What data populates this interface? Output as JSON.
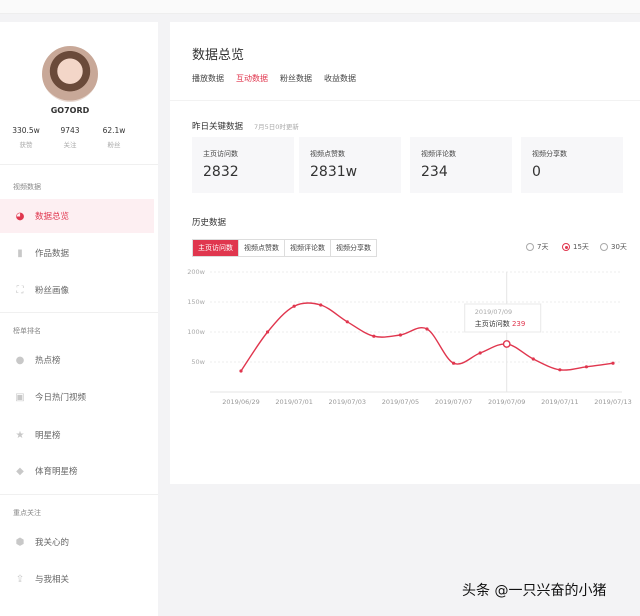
{
  "profile": {
    "username": "GO7ORD",
    "stats": [
      {
        "value": "330.5w",
        "label": "获赞"
      },
      {
        "value": "9743",
        "label": "关注"
      },
      {
        "value": "62.1w",
        "label": "粉丝"
      }
    ]
  },
  "sidebar": {
    "sections": [
      {
        "title": "视频数据",
        "items": [
          {
            "label": "数据总览",
            "icon": "pie-chart-icon",
            "active": true
          },
          {
            "label": "作品数据",
            "icon": "bar-chart-icon"
          },
          {
            "label": "粉丝画像",
            "icon": "portrait-icon"
          }
        ]
      },
      {
        "title": "榜单排名",
        "items": [
          {
            "label": "热点榜",
            "icon": "flame-icon"
          },
          {
            "label": "今日热门视频",
            "icon": "play-square-icon"
          },
          {
            "label": "明星榜",
            "icon": "star-icon"
          },
          {
            "label": "体育明星榜",
            "icon": "diamond-icon"
          }
        ]
      },
      {
        "title": "重点关注",
        "items": [
          {
            "label": "我关心的",
            "icon": "heart-shield-icon"
          },
          {
            "label": "与我相关",
            "icon": "share-icon"
          }
        ]
      }
    ]
  },
  "main": {
    "title": "数据总览",
    "tabs": [
      {
        "label": "播放数据"
      },
      {
        "label": "互动数据",
        "active": true
      },
      {
        "label": "粉丝数据"
      },
      {
        "label": "收益数据"
      }
    ],
    "kpi_title": "昨日关键数据",
    "kpi_subtitle": "7月5日0时更新",
    "kpis": [
      {
        "label": "主页访问数",
        "value": "2832"
      },
      {
        "label": "视频点赞数",
        "value": "2831w"
      },
      {
        "label": "视频评论数",
        "value": "234"
      },
      {
        "label": "视频分享数",
        "value": "0"
      }
    ],
    "history_title": "历史数据",
    "metric_tabs": [
      {
        "label": "主页访问数",
        "active": true
      },
      {
        "label": "视频点赞数"
      },
      {
        "label": "视频评论数"
      },
      {
        "label": "视频分享数"
      }
    ],
    "ranges": [
      {
        "label": "7天"
      },
      {
        "label": "15天",
        "selected": true
      },
      {
        "label": "30天"
      }
    ]
  },
  "colors": {
    "accent": "#e0364e"
  },
  "chart_data": {
    "type": "line",
    "x": [
      "2019/06/29",
      "2019/06/30",
      "2019/07/01",
      "2019/07/02",
      "2019/07/03",
      "2019/07/04",
      "2019/07/05",
      "2019/07/06",
      "2019/07/07",
      "2019/07/08",
      "2019/07/09",
      "2019/07/10",
      "2019/07/11",
      "2019/07/12",
      "2019/07/13"
    ],
    "xticks": [
      "2019/06/29",
      "2019/07/01",
      "2019/07/03",
      "2019/07/05",
      "2019/07/07",
      "2019/07/09",
      "2019/07/11",
      "2019/07/13"
    ],
    "yticks": [
      "50w",
      "100w",
      "150w",
      "200w"
    ],
    "ylim": [
      0,
      200
    ],
    "series": [
      {
        "values": [
          35,
          100,
          143,
          145,
          117,
          93,
          95,
          105,
          48,
          65,
          80,
          55,
          37,
          42,
          48
        ]
      }
    ],
    "tooltip": {
      "date": "2019/07/09",
      "label": "主页访问数",
      "value": "239"
    }
  }
}
